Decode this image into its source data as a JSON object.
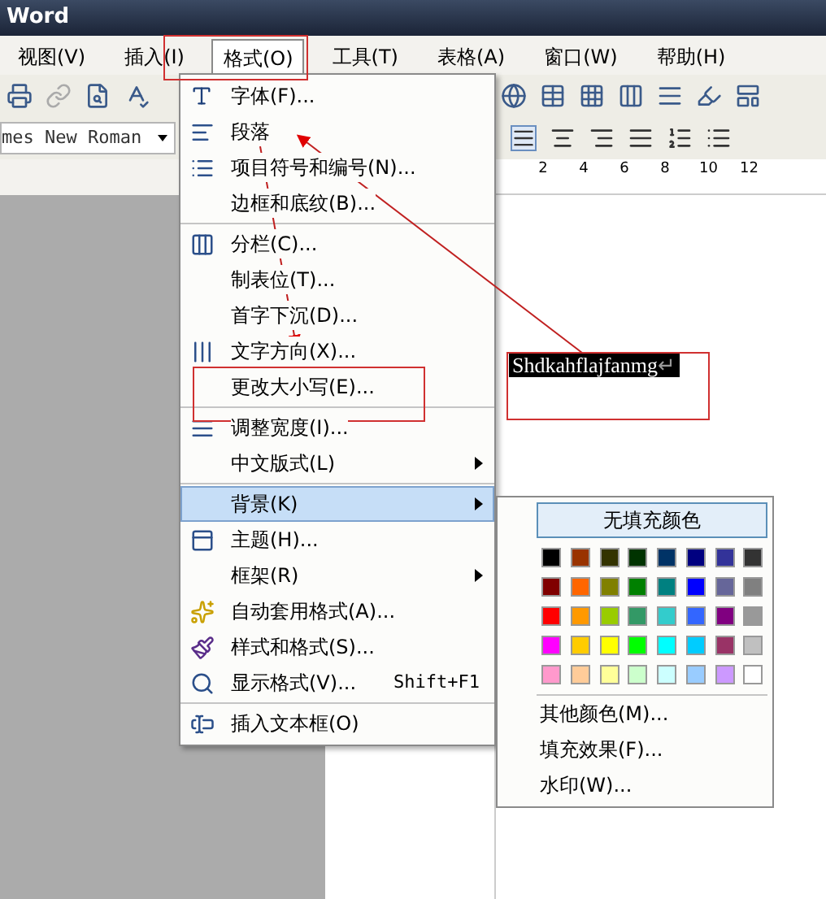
{
  "window": {
    "title": "Word"
  },
  "menu_bar": [
    {
      "label": "视图(V)",
      "selected": false
    },
    {
      "label": "插入(I)",
      "selected": false
    },
    {
      "label": "格式(O)",
      "selected": true
    },
    {
      "label": "工具(T)",
      "selected": false
    },
    {
      "label": "表格(A)",
      "selected": false
    },
    {
      "label": "窗口(W)",
      "selected": false
    },
    {
      "label": "帮助(H)",
      "selected": false
    }
  ],
  "font_box": {
    "value": "mes New Roman"
  },
  "ruler": {
    "numbers": [
      "2",
      "4",
      "6",
      "8",
      "10",
      "12"
    ]
  },
  "format_menu": {
    "groups": [
      [
        {
          "label": "字体(F)...",
          "selected": false,
          "submenu": false
        },
        {
          "label": "段落",
          "selected": false,
          "submenu": false
        },
        {
          "label": "项目符号和编号(N)...",
          "selected": false,
          "submenu": false
        },
        {
          "label": "边框和底纹(B)...",
          "selected": false,
          "submenu": false
        }
      ],
      [
        {
          "label": "分栏(C)...",
          "selected": false,
          "submenu": false
        },
        {
          "label": "制表位(T)...",
          "selected": false,
          "submenu": false
        },
        {
          "label": "首字下沉(D)...",
          "selected": false,
          "submenu": false
        },
        {
          "label": "文字方向(X)...",
          "selected": false,
          "submenu": false
        },
        {
          "label": "更改大小写(E)...",
          "selected": false,
          "submenu": false
        }
      ],
      [
        {
          "label": "调整宽度(I)...",
          "selected": false,
          "submenu": false
        },
        {
          "label": "中文版式(L)",
          "selected": false,
          "submenu": true
        }
      ],
      [
        {
          "label": "背景(K)",
          "selected": true,
          "submenu": true
        },
        {
          "label": "主题(H)...",
          "selected": false,
          "submenu": false
        },
        {
          "label": "框架(R)",
          "selected": false,
          "submenu": true
        },
        {
          "label": "自动套用格式(A)...",
          "selected": false,
          "submenu": false
        },
        {
          "label": "样式和格式(S)...",
          "selected": false,
          "submenu": false
        },
        {
          "label": "显示格式(V)...",
          "shortcut": "Shift+F1",
          "selected": false,
          "submenu": false
        }
      ],
      [
        {
          "label": "插入文本框(O)",
          "selected": false,
          "submenu": false
        }
      ]
    ]
  },
  "background_submenu": {
    "no_fill": "无填充颜色",
    "swatches": [
      {
        "color": "#000000"
      },
      {
        "color": "#993300"
      },
      {
        "color": "#333300"
      },
      {
        "color": "#003300"
      },
      {
        "color": "#003366"
      },
      {
        "color": "#000080"
      },
      {
        "color": "#333399"
      },
      {
        "color": "#333333"
      },
      {
        "color": "#800000"
      },
      {
        "color": "#ff6600"
      },
      {
        "color": "#808000"
      },
      {
        "color": "#008000"
      },
      {
        "color": "#008080"
      },
      {
        "color": "#0000ff"
      },
      {
        "color": "#666699"
      },
      {
        "color": "#808080"
      },
      {
        "color": "#ff0000"
      },
      {
        "color": "#ff9900"
      },
      {
        "color": "#99cc00"
      },
      {
        "color": "#339966"
      },
      {
        "color": "#33cccc"
      },
      {
        "color": "#3366ff"
      },
      {
        "color": "#800080"
      },
      {
        "color": "#999999"
      },
      {
        "color": "#ff00ff"
      },
      {
        "color": "#ffcc00"
      },
      {
        "color": "#ffff00"
      },
      {
        "color": "#00ff00"
      },
      {
        "color": "#00ffff"
      },
      {
        "color": "#00ccff"
      },
      {
        "color": "#993366"
      },
      {
        "color": "#c0c0c0"
      },
      {
        "color": "#ff99cc"
      },
      {
        "color": "#ffcc99"
      },
      {
        "color": "#ffff99"
      },
      {
        "color": "#ccffcc"
      },
      {
        "color": "#ccffff"
      },
      {
        "color": "#99ccff"
      },
      {
        "color": "#cc99ff"
      },
      {
        "color": "#ffffff"
      }
    ],
    "items": [
      "其他颜色(M)...",
      "填充效果(F)...",
      "水印(W)..."
    ]
  },
  "document": {
    "text": "Shdkahflajfanmg",
    "mark": "↵"
  }
}
